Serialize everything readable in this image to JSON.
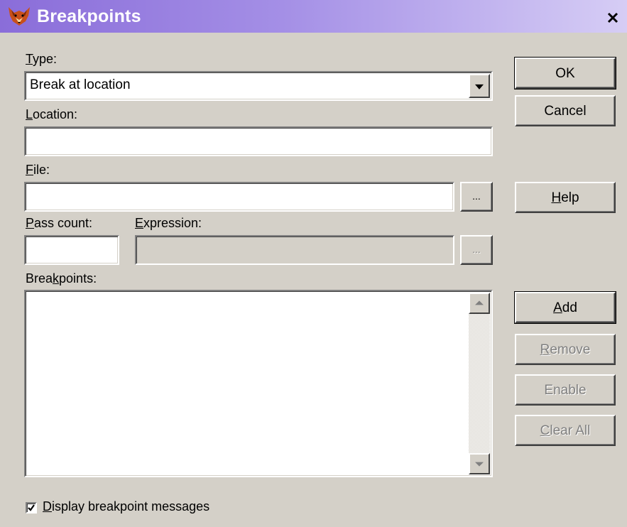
{
  "window": {
    "title": "Breakpoints",
    "close_glyph": "✕",
    "title_gradient": [
      "#8a6dd9",
      "#d6cdf5"
    ]
  },
  "type_section": {
    "label_accel": "T",
    "label_rest": "ype:",
    "selected_value": "Break at location"
  },
  "location_section": {
    "label_accel": "L",
    "label_rest": "ocation:",
    "value": ""
  },
  "file_section": {
    "label_accel": "F",
    "label_rest": "ile:",
    "value": "",
    "browse_label": "..."
  },
  "pass_count_section": {
    "label_accel": "P",
    "label_rest": "ass count:",
    "value": ""
  },
  "expression_section": {
    "label_accel": "E",
    "label_rest": "xpression:",
    "value": "",
    "browse_label": "..."
  },
  "breakpoints_section": {
    "label_pre": "Brea",
    "label_accel": "k",
    "label_rest": "points:",
    "items": []
  },
  "buttons": {
    "ok": "OK",
    "cancel": "Cancel",
    "help_accel": "H",
    "help_rest": "elp",
    "add_accel": "A",
    "add_rest": "dd",
    "remove_accel": "R",
    "remove_rest": "emove",
    "enable": "Enable",
    "clear_accel": "C",
    "clear_rest": "lear All"
  },
  "options": {
    "display_messages_checked": true,
    "display_messages_accel": "D",
    "display_messages_rest": "isplay breakpoint messages"
  }
}
